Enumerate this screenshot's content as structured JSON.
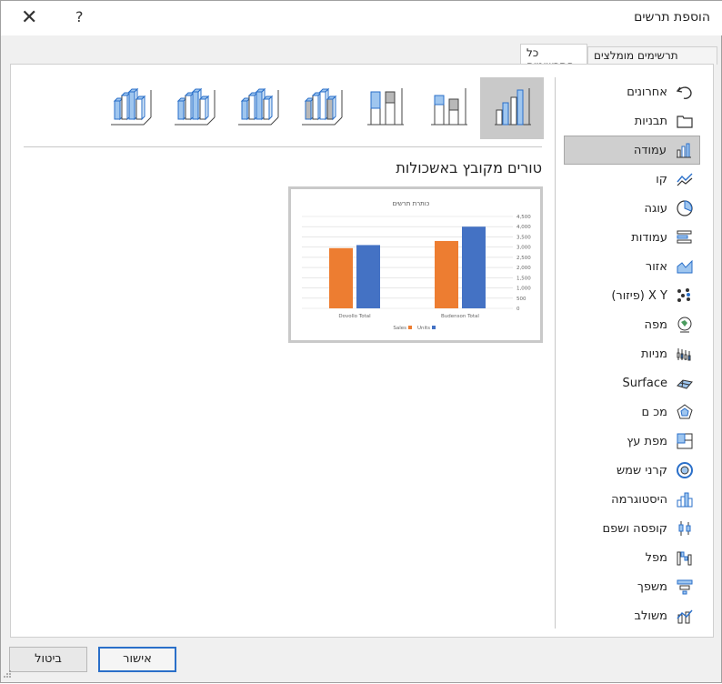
{
  "window": {
    "title": "הוספת תרשים",
    "help": "?",
    "close": "✕"
  },
  "tabs": [
    {
      "label": "תרשימים מומלצים"
    },
    {
      "label": "כל התרשימים"
    }
  ],
  "categories": [
    {
      "label": "אחרונים",
      "icon": "undo-icon"
    },
    {
      "label": "תבניות",
      "icon": "folder-icon"
    },
    {
      "label": "עמודה",
      "icon": "column-chart-icon"
    },
    {
      "label": "קו",
      "icon": "line-chart-icon"
    },
    {
      "label": "עוגה",
      "icon": "pie-chart-icon"
    },
    {
      "label": "עמודות",
      "icon": "bar-chart-icon"
    },
    {
      "label": "אזור",
      "icon": "area-chart-icon"
    },
    {
      "label": "X Y (פיזור)",
      "icon": "scatter-chart-icon"
    },
    {
      "label": "מפה",
      "icon": "map-chart-icon"
    },
    {
      "label": "מניות",
      "icon": "stock-chart-icon"
    },
    {
      "label": "Surface",
      "icon": "surface-chart-icon"
    },
    {
      "label": "מכ ם",
      "icon": "radar-chart-icon"
    },
    {
      "label": "מפת עץ",
      "icon": "treemap-chart-icon"
    },
    {
      "label": "קרני שמש",
      "icon": "sunburst-chart-icon"
    },
    {
      "label": "היסטוגרמה",
      "icon": "histogram-chart-icon"
    },
    {
      "label": "קופסה ושפם",
      "icon": "box-whisker-chart-icon"
    },
    {
      "label": "מפל",
      "icon": "waterfall-chart-icon"
    },
    {
      "label": "משפך",
      "icon": "funnel-chart-icon"
    },
    {
      "label": "משולב",
      "icon": "combo-chart-icon"
    }
  ],
  "selected_category": "עמודה",
  "subtypes_selected": 0,
  "preview": {
    "heading": "טורים מקובץ באשכולות",
    "chart_title": "כותרת תרשים",
    "categories": [
      "Budenson Total",
      "Dovollo Total"
    ],
    "yticks": [
      "4,500",
      "4,000",
      "3,500",
      "3,000",
      "2,500",
      "2,000",
      "1,500",
      "1,000",
      "500",
      "0"
    ],
    "legend": [
      "Units",
      "Sales"
    ]
  },
  "chart_data": {
    "type": "bar",
    "title": "כותרת תרשים",
    "categories": [
      "Budenson Total",
      "Dovollo Total"
    ],
    "series": [
      {
        "name": "Units",
        "values": [
          4000,
          3100
        ]
      },
      {
        "name": "Sales",
        "values": [
          3300,
          2950
        ]
      }
    ],
    "ylim": [
      0,
      4500
    ],
    "legend_position": "bottom"
  },
  "colors": {
    "accent": "#4472c4",
    "orange": "#ed7d31",
    "selected": "#c9c9c9"
  },
  "buttons": {
    "ok": "אישור",
    "cancel": "ביטול"
  }
}
